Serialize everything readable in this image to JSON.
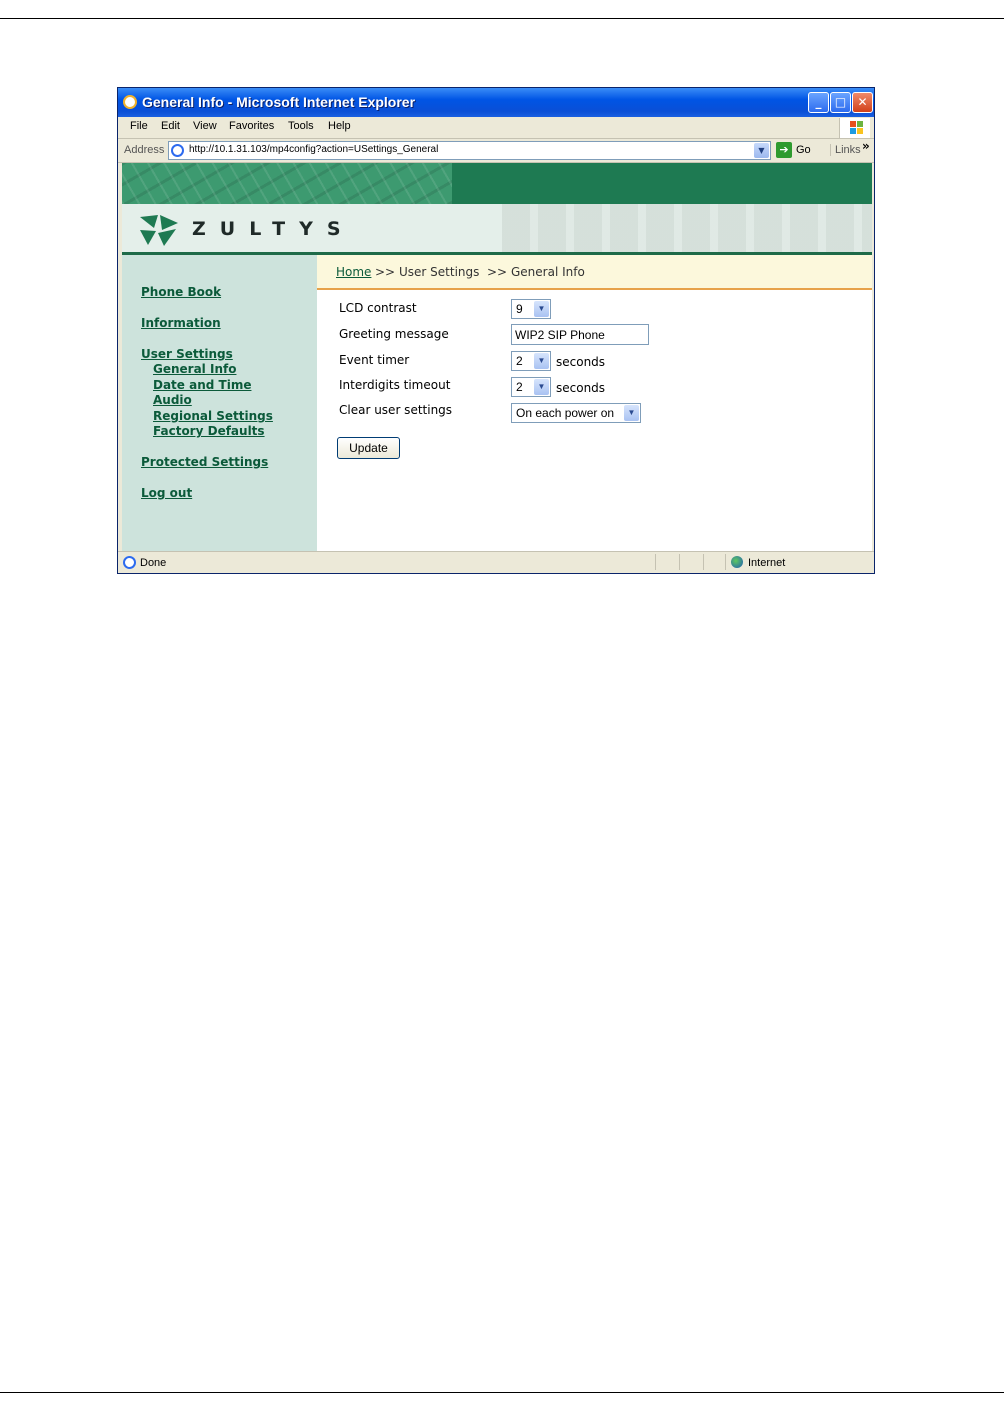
{
  "window": {
    "title": "General Info - Microsoft Internet Explorer",
    "controls": {
      "minimize": "_",
      "maximize": "□",
      "close": "✕"
    }
  },
  "menubar": {
    "items": [
      "File",
      "Edit",
      "View",
      "Favorites",
      "Tools",
      "Help"
    ]
  },
  "addressbar": {
    "label": "Address",
    "url": "http://10.1.31.103/mp4config?action=USettings_General",
    "go_label": "Go",
    "links_label": "Links",
    "chevron": "»"
  },
  "banner": {
    "logo_text": "ZULTYS"
  },
  "sidebar": {
    "items": [
      {
        "label": "Phone Book"
      },
      {
        "label": "Information"
      },
      {
        "label": "User Settings"
      },
      {
        "label": "General Info"
      },
      {
        "label": "Date and Time"
      },
      {
        "label": "Audio"
      },
      {
        "label": "Regional Settings"
      },
      {
        "label": "Factory Defaults"
      },
      {
        "label": "Protected Settings"
      },
      {
        "label": "Log out"
      }
    ]
  },
  "breadcrumb": {
    "home": "Home",
    "sep1": ">>",
    "section": "User Settings",
    "sep2": ">>",
    "page": "General Info"
  },
  "form": {
    "lcd_contrast": {
      "label": "LCD contrast",
      "value": "9"
    },
    "greeting_message": {
      "label": "Greeting message",
      "value": "WIP2 SIP Phone"
    },
    "event_timer": {
      "label": "Event timer",
      "value": "2",
      "unit": "seconds"
    },
    "interdigits_timeout": {
      "label": "Interdigits timeout",
      "value": "2",
      "unit": "seconds"
    },
    "clear_user_settings": {
      "label": "Clear user settings",
      "value": "On each power on"
    },
    "update_label": "Update"
  },
  "statusbar": {
    "status": "Done",
    "zone": "Internet"
  },
  "colors": {
    "brand_green": "#1e7a52",
    "link_green": "#0b5a3a",
    "sidebar_bg": "#cde3dc",
    "breadcrumb_bg": "#fcf8dc",
    "accent_orange": "#e7a24a"
  }
}
